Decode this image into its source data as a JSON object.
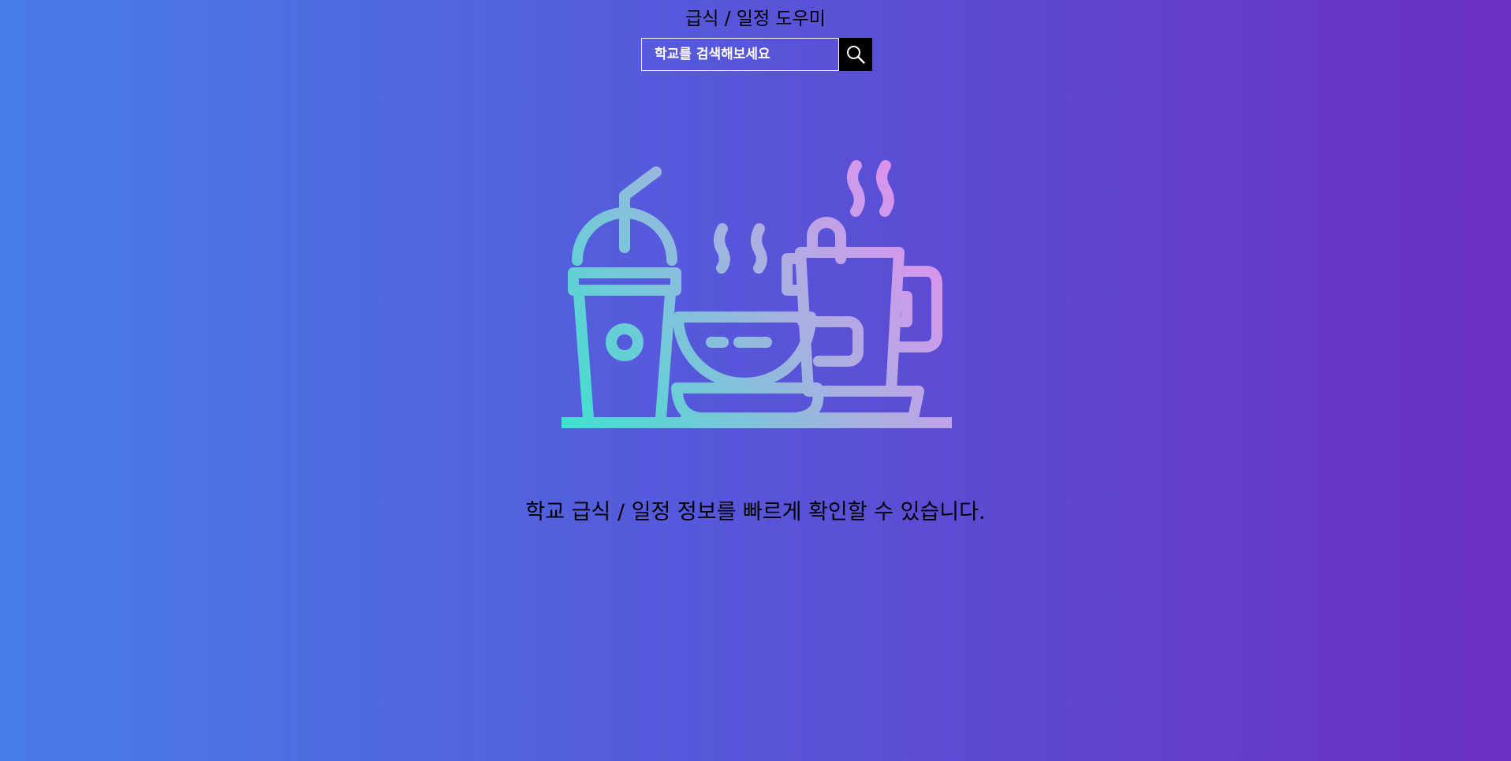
{
  "header": {
    "title": "급식 / 일정 도우미"
  },
  "search": {
    "placeholder": "학교를 검색해보세요",
    "button_icon": "search-icon"
  },
  "hero": {
    "illustration_icon": "food-and-drinks-icon",
    "gradient_colors": [
      "#3fe1d0",
      "#a6b1e0",
      "#e68cf0"
    ]
  },
  "main": {
    "tagline": "학교 급식 / 일정 정보를 빠르게 확인할 수 있습니다."
  },
  "theme": {
    "background_start": "#477ee5",
    "background_end": "#6a2fc4"
  }
}
